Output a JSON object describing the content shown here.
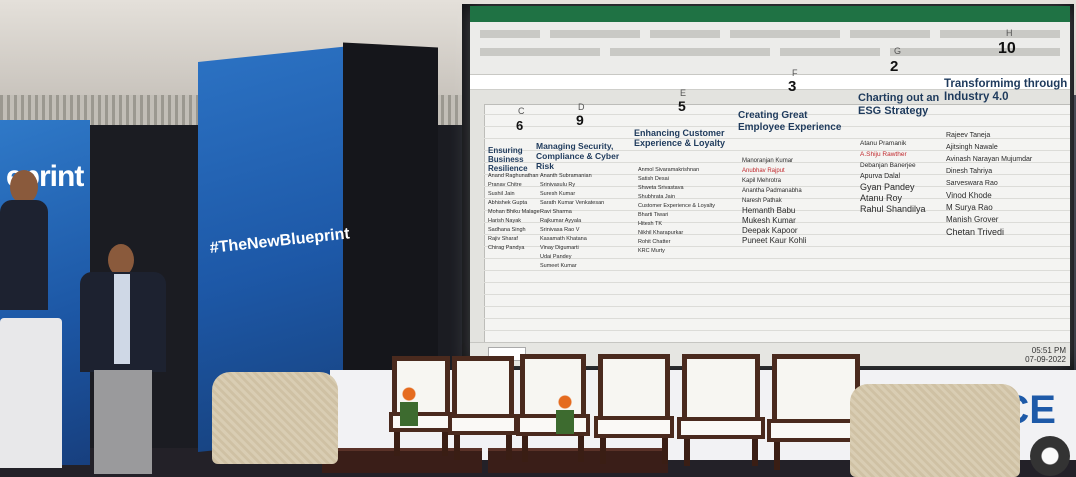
{
  "photo": {
    "stage_hashtag": "#TheNewBlueprint",
    "left_banner_text": "eprint",
    "stage_backdrop_text": "CE"
  },
  "spreadsheet": {
    "columns": [
      {
        "letter": "C",
        "count": "6",
        "heading": "Ensuring Business Resilience",
        "names": [
          "Anand Raghunathan",
          "Pranav Chitre",
          "Sushil Jain",
          "Abhishek Gupta",
          "Mohan Bhiku Malage",
          "Harish Nayak",
          "Sadhana Singh",
          "Rajiv Sharaf",
          "Chirag Pandya"
        ]
      },
      {
        "letter": "D",
        "count": "9",
        "heading": "Managing Security, Compliance & Cyber Risk",
        "names": [
          "Ananth Subramanian",
          "Srinivasulu Ry",
          "Suresh Kumar",
          "Sarath Kumar Venkatesan",
          "Ravi Sharma",
          "Rajkumar Ayyala",
          "Srinivasa Rao V",
          "Kasamath Khatana",
          "Vinay Digumarti",
          "Udai Pandey",
          "Sumeet Kumar"
        ]
      },
      {
        "letter": "E",
        "count": "5",
        "heading": "Enhancing Customer Experience & Loyalty",
        "names": [
          "Anmol Sivaramakrishnan",
          "Satish Desai",
          "Shweta Srivastava",
          "Shubhrata Jain",
          "Customer Experience & Loyalty",
          "Bharti Tiwari",
          "Hitesh TK",
          "Nikhil Kharapurkar",
          "Rohit Chatter",
          "KRC Murty"
        ]
      },
      {
        "letter": "F",
        "count": "3",
        "heading": "Creating Great Employee Experience",
        "names": [
          "Manoranjan Kumar",
          "Anubhav Rajput",
          "Kapil Mehrotra",
          "Anantha Padmanabha",
          "Naresh Pathak",
          "Hemanth Babu",
          "Mukesh Kumar",
          "Deepak Kapoor",
          "Puneet Kaur Kohli"
        ],
        "red_index": 1
      },
      {
        "letter": "G",
        "count": "2",
        "heading": "Charting out an ESG Strategy",
        "names": [
          "Atanu Pramanik",
          "A.Shiju Rawther",
          "Debanjan Banerjee",
          "Apurva Dalal",
          "Gyan Pandey",
          "Atanu Roy",
          "Rahul Shandilya"
        ],
        "red_index": 1
      },
      {
        "letter": "H",
        "count": "10",
        "heading": "Transformimg through Industry 4.0",
        "names": [
          "Rajeev Taneja",
          "Ajitsingh Nawale",
          "Avinash Narayan Mujumdar",
          "Dinesh Tahriya",
          "Sarveswara Rao",
          "Vinod Khode",
          "M Surya Rao",
          "Manish Grover",
          "Chetan Trivedi"
        ]
      }
    ],
    "clock": "05:51 PM",
    "date": "07-09-2022"
  }
}
